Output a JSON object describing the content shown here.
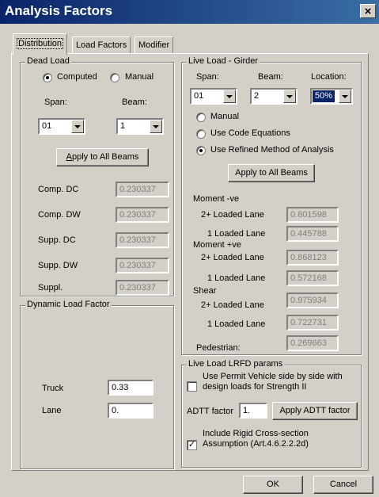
{
  "window": {
    "title": "Analysis Factors",
    "close_glyph": "×"
  },
  "tabs": [
    {
      "label": "Distribution",
      "active": true
    },
    {
      "label": "Load Factors",
      "active": false
    },
    {
      "label": "Modifier",
      "active": false
    }
  ],
  "dead_load": {
    "title": "Dead Load",
    "radio_computed": "Computed",
    "radio_manual": "Manual",
    "selected_mode": "Computed",
    "span_label": "Span:",
    "span_value": "01",
    "beam_label": "Beam:",
    "beam_value": "1",
    "apply_button": "Apply to All Beams",
    "rows": [
      {
        "label": "Comp. DC",
        "value": "0.230337"
      },
      {
        "label": "Comp. DW",
        "value": "0.230337"
      },
      {
        "label": "Supp. DC",
        "value": "0.230337"
      },
      {
        "label": "Supp. DW",
        "value": "0.230337"
      },
      {
        "label": "Suppl.",
        "value": "0.230337"
      }
    ]
  },
  "dynamic_load": {
    "title": "Dynamic Load Factor",
    "truck_label": "Truck",
    "truck_value": "0.33",
    "lane_label": "Lane",
    "lane_value": "0."
  },
  "live_load_girder": {
    "title": "Live Load - Girder",
    "span_label": "Span:",
    "span_value": "01",
    "beam_label": "Beam:",
    "beam_value": "2",
    "location_label": "Location:",
    "location_value": "50%",
    "radio_manual": "Manual",
    "radio_code": "Use Code Equations",
    "radio_refined": "Use Refined Method of Analysis",
    "selected_method": "Use Refined Method of Analysis",
    "apply_button": "Apply to All Beams",
    "moment_neg_label": "Moment -ve",
    "moment_pos_label": "Moment +ve",
    "shear_label": "Shear",
    "two_lane_label": "2+ Loaded Lane",
    "one_lane_label": "1 Loaded Lane",
    "moment_neg_2": "0.801598",
    "moment_neg_1": "0.445788",
    "moment_pos_2": "0.868123",
    "moment_pos_1": "0.572168",
    "shear_2": "0.975934",
    "shear_1": "0.722731",
    "pedestrian_label": "Pedestrian:",
    "pedestrian_value": "0.269663"
  },
  "lrfd": {
    "title": "Live Load LRFD params",
    "permit_label_1": "Use Permit Vehicle side by side with",
    "permit_label_2": "design loads for Strength II",
    "permit_checked": false,
    "adtt_label": "ADTT factor",
    "adtt_value": "1.",
    "apply_adtt_button": "Apply ADTT factor",
    "rigid_label_1": "Include Rigid Cross-section",
    "rigid_label_2": "Assumption (Art.4.6.2.2.2d)",
    "rigid_checked": true,
    "check_glyph": "✓"
  },
  "footer": {
    "ok_button": "OK",
    "cancel_button": "Cancel"
  }
}
